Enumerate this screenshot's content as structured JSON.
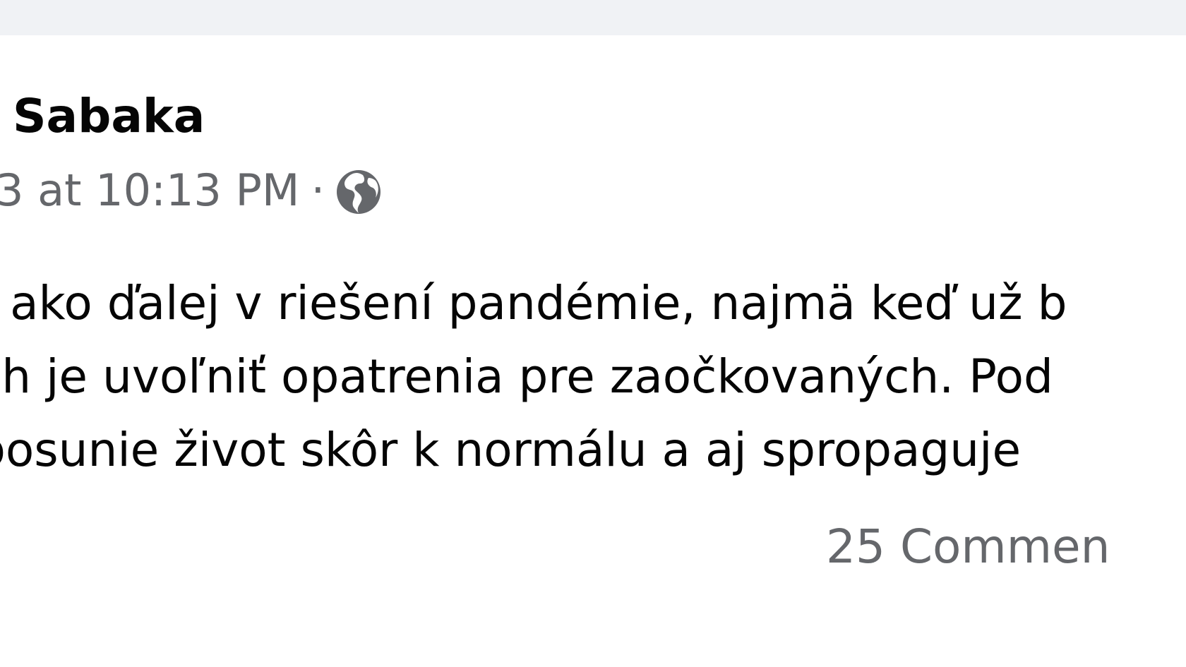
{
  "post": {
    "author_name": "Sabaka",
    "timestamp": "3 at 10:13 PM",
    "separator": "·",
    "audience_icon": "globe-icon",
    "text_lines": [
      "r ako ďalej v riešení pandémie, najmä keď už b",
      "ch je uvoľniť opatrenia pre zaočkovaných. Pod",
      "posunie život skôr k normálu a aj spropaguje"
    ],
    "comments_label": "25 Commen"
  },
  "colors": {
    "page_background": "#f0f2f5",
    "card_background": "#ffffff",
    "primary_text": "#050505",
    "secondary_text": "#65676b"
  }
}
